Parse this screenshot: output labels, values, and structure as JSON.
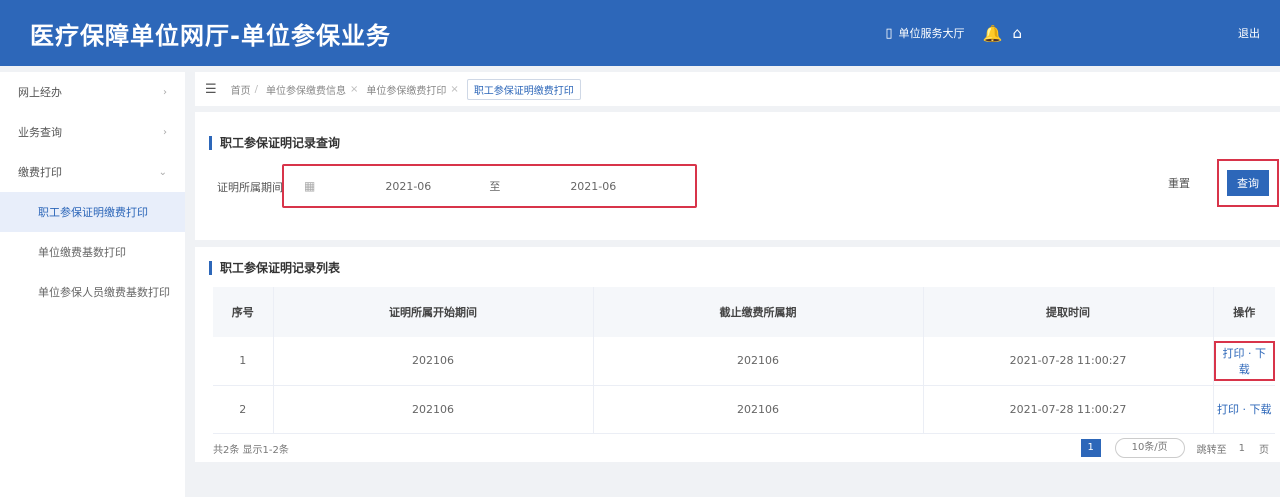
{
  "header": {
    "title": "医疗保障单位网厅-单位参保业务",
    "service_hall": "单位服务大厅",
    "user_name": "",
    "exit": "退出"
  },
  "sidebar": {
    "items": [
      {
        "label": "网上经办"
      },
      {
        "label": "业务查询"
      },
      {
        "label": "缴费打印"
      }
    ],
    "subitems": [
      {
        "label": "职工参保证明缴费打印",
        "active": true
      },
      {
        "label": "单位缴费基数打印",
        "active": false
      },
      {
        "label": "单位参保人员缴费基数打印",
        "active": false
      }
    ]
  },
  "breadcrumb": {
    "items": [
      "首页",
      "单位参保缴费信息",
      "单位参保缴费打印",
      "职工参保证明缴费打印"
    ]
  },
  "search": {
    "section_title": "职工参保证明记录查询",
    "label": "证明所属期间",
    "start": "2021-06",
    "to": "至",
    "end": "2021-06",
    "reset": "重置",
    "query": "查询"
  },
  "list": {
    "section_title": "职工参保证明记录列表",
    "columns": [
      "序号",
      "证明所属开始期间",
      "截止缴费所属期",
      "提取时间",
      "操作"
    ],
    "rows": [
      {
        "idx": "1",
        "start": "202106",
        "end": "202106",
        "time": "2021-07-28 11:00:27",
        "ops": "打印 · 下载"
      },
      {
        "idx": "2",
        "start": "202106",
        "end": "202106",
        "time": "2021-07-28 11:00:27",
        "ops": "打印 · 下载"
      }
    ]
  },
  "pager": {
    "total": "共2条 显示1-2条",
    "current": "1",
    "page_size": "10条/页",
    "goto": "跳转至",
    "goto_value": "1",
    "unit": "页"
  },
  "colors": {
    "primary": "#2d67b9",
    "highlight": "#d8344a"
  }
}
